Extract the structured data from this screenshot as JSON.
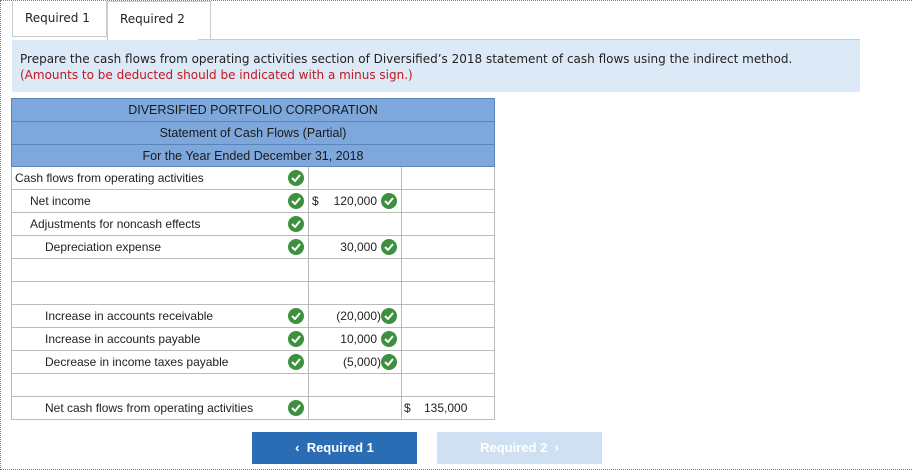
{
  "tabs": [
    {
      "label": "Required 1"
    },
    {
      "label": "Required 2"
    }
  ],
  "instructions": {
    "text": "Prepare the cash flows from operating activities section of Diversified’s 2018 statement of cash flows using the indirect method.",
    "note": "(Amounts to be deducted should be indicated with a minus sign.)"
  },
  "statement": {
    "company": "DIVERSIFIED PORTFOLIO CORPORATION",
    "title": "Statement of Cash Flows (Partial)",
    "period": "For the Year Ended December 31, 2018",
    "rows": [
      {
        "label": "Cash flows from operating activities",
        "amount": "",
        "total": ""
      },
      {
        "label": "Net income",
        "amount": "120,000",
        "total": ""
      },
      {
        "label": "Adjustments for noncash effects",
        "amount": "",
        "total": ""
      },
      {
        "label": "Depreciation expense",
        "amount": "30,000",
        "total": ""
      },
      {
        "label": "",
        "amount": "",
        "total": ""
      },
      {
        "label": "",
        "amount": "",
        "total": ""
      },
      {
        "label": "Increase in accounts receivable",
        "amount": "(20,000)",
        "total": ""
      },
      {
        "label": "Increase in accounts payable",
        "amount": "10,000",
        "total": ""
      },
      {
        "label": "Decrease in income taxes payable",
        "amount": "(5,000)",
        "total": ""
      },
      {
        "label": "",
        "amount": "",
        "total": ""
      },
      {
        "label": "Net cash flows from operating activities",
        "amount": "",
        "total": "135,000"
      }
    ],
    "dollar_sign": "$"
  },
  "nav": {
    "prev_label": "Required 1",
    "next_label": "Required 2",
    "prev_icon": "chevron-left-icon",
    "next_icon": "chevron-right-icon"
  },
  "colors": {
    "header_blue": "#7ea7dc",
    "instruction_bg": "#dce9f6",
    "check_green": "#3e8f3e",
    "button_blue": "#2a6db5",
    "note_red": "#c2171d"
  }
}
